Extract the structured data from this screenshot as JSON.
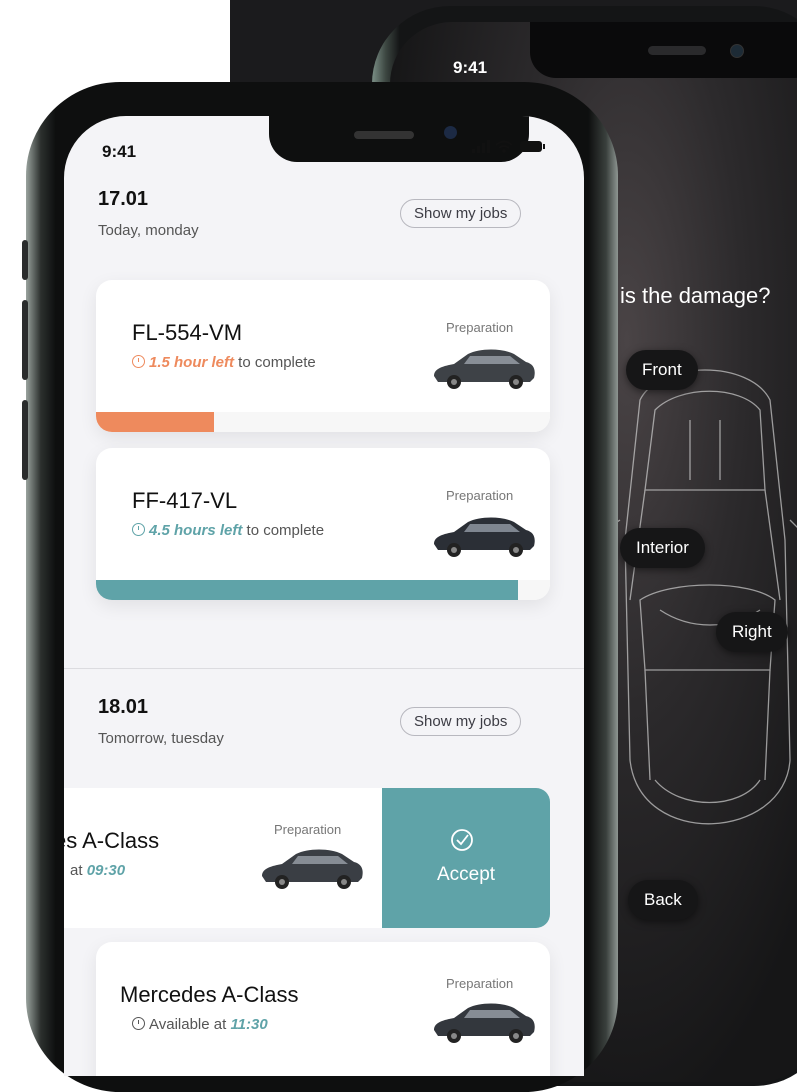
{
  "back_phone": {
    "time": "9:41",
    "question": "is the damage?",
    "options": [
      "Front",
      "Interior",
      "Right",
      "Back"
    ]
  },
  "front_phone": {
    "time": "9:41",
    "sections": [
      {
        "date": "17.01",
        "day": "Today, monday",
        "show_jobs": "Show my jobs",
        "jobs": [
          {
            "plate": "FL-554-VM",
            "time_left": "1.5 hour left",
            "suffix": " to complete",
            "status": "Preparation",
            "progress": 0.26,
            "color": "#ee8a5d"
          },
          {
            "plate": "FF-417-VL",
            "time_left": "4.5 hours left",
            "suffix": " to complete",
            "status": "Preparation",
            "progress": 0.93,
            "color": "#5fa3a8"
          }
        ]
      },
      {
        "date": "18.01",
        "day": "Tomorrow, tuesday",
        "show_jobs": "Show my jobs",
        "jobs": [
          {
            "name": "es A-Class",
            "avail_prefix": "at ",
            "avail_time": "09:30",
            "status": "Preparation",
            "action": "Accept"
          },
          {
            "name": "Mercedes A-Class",
            "avail_prefix": "Available at ",
            "avail_time": "11:30",
            "status": "Preparation"
          }
        ]
      }
    ]
  },
  "colors": {
    "orange": "#ee8a5d",
    "teal": "#5fa3a8"
  }
}
